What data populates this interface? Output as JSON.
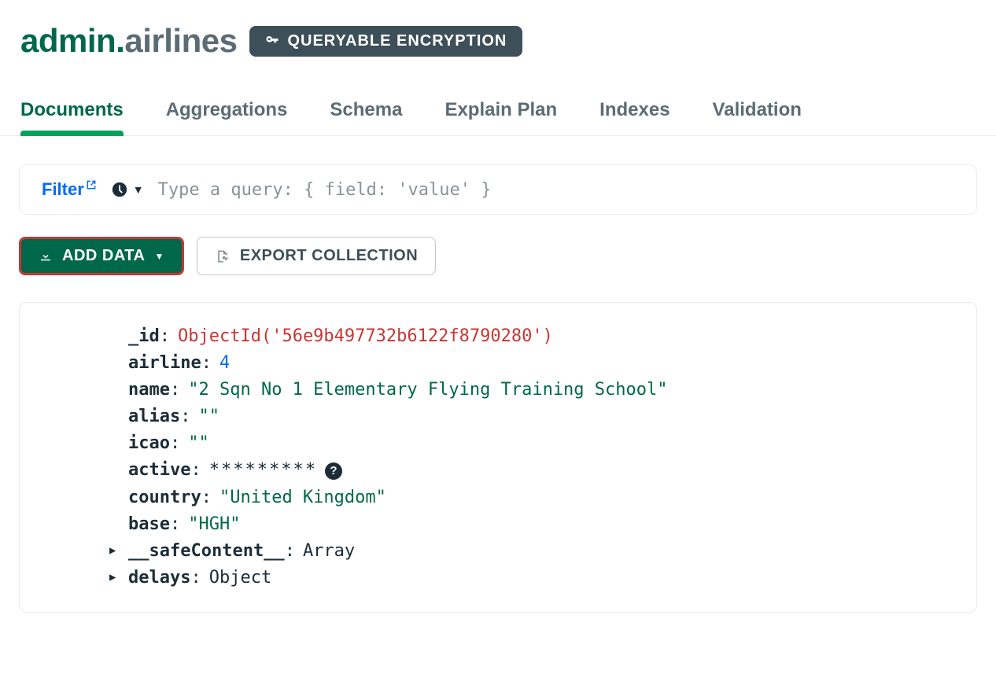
{
  "header": {
    "db": "admin",
    "collection": "airlines",
    "encryption_badge": "QUERYABLE ENCRYPTION"
  },
  "tabs": [
    {
      "label": "Documents",
      "active": true
    },
    {
      "label": "Aggregations",
      "active": false
    },
    {
      "label": "Schema",
      "active": false
    },
    {
      "label": "Explain Plan",
      "active": false
    },
    {
      "label": "Indexes",
      "active": false
    },
    {
      "label": "Validation",
      "active": false
    }
  ],
  "filter": {
    "link_label": "Filter",
    "query_placeholder": "Type a query: { field: 'value' }"
  },
  "toolbar": {
    "add_data_label": "ADD DATA",
    "export_label": "EXPORT COLLECTION"
  },
  "document": {
    "fields": [
      {
        "key": "_id",
        "type": "oid",
        "value": "ObjectId('56e9b497732b6122f8790280')"
      },
      {
        "key": "airline",
        "type": "num",
        "value": "4"
      },
      {
        "key": "name",
        "type": "str",
        "value": "\"2 Sqn No 1 Elementary Flying Training School\""
      },
      {
        "key": "alias",
        "type": "str",
        "value": "\"\""
      },
      {
        "key": "icao",
        "type": "str",
        "value": "\"\""
      },
      {
        "key": "active",
        "type": "masked",
        "value": "*********",
        "help": true
      },
      {
        "key": "country",
        "type": "str",
        "value": "\"United Kingdom\""
      },
      {
        "key": "base",
        "type": "str",
        "value": "\"HGH\""
      },
      {
        "key": "__safeContent__",
        "type": "plain",
        "value": "Array",
        "expandable": true
      },
      {
        "key": "delays",
        "type": "plain",
        "value": "Object",
        "expandable": true
      }
    ]
  }
}
